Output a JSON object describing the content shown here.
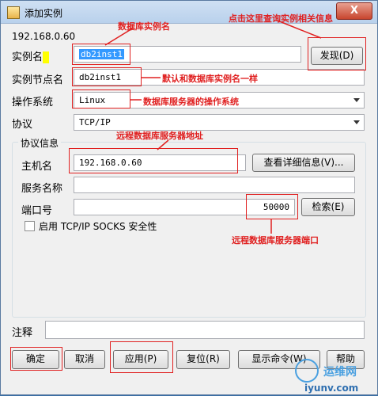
{
  "window": {
    "title": "添加实例",
    "close_glyph": "X"
  },
  "host_header": "192.168.0.60",
  "instance": {
    "label": "实例名",
    "value": "db2inst1",
    "discover_button": "发现(D)"
  },
  "node": {
    "label": "实例节点名",
    "value": "db2inst1"
  },
  "os": {
    "label": "操作系统",
    "value": "Linux"
  },
  "protocol": {
    "label": "协议",
    "value": "TCP/IP"
  },
  "protocol_info": {
    "title": "协议信息",
    "host_label": "主机名",
    "host_value": "192.168.0.60",
    "details_button": "查看详细信息(V)...",
    "service_label": "服务名称",
    "service_value": "",
    "port_label": "端口号",
    "port_value": "50000",
    "search_button": "检索(E)",
    "socks_label": "启用 TCP/IP SOCKS 安全性"
  },
  "comment": {
    "label": "注释",
    "value": ""
  },
  "buttons": {
    "ok": "确定",
    "cancel": "取消",
    "apply": "应用(P)",
    "reset": "复位(R)",
    "show_command": "显示命令(W)",
    "help": "帮助"
  },
  "annotations": {
    "instance_name": "数据库实例名",
    "discover_hint": "点击这里查询实例相关信息",
    "node_default": "默认和数据库实例名一样",
    "os_hint": "数据库服务器的操作系统",
    "host_hint": "远程数据库服务器地址",
    "port_hint": "远程数据库服务器端口"
  },
  "watermark": {
    "cn": "运维网",
    "url": "iyunv.com"
  },
  "colors": {
    "annotation_red": "#e02020",
    "selection_blue": "#3399ff",
    "highlight_yellow": "#ffff00"
  }
}
